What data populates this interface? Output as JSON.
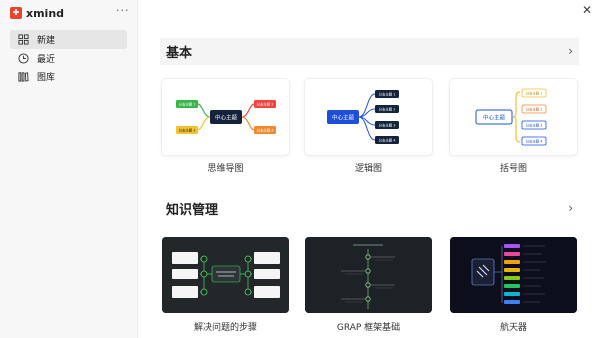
{
  "brand": {
    "name": "xmind",
    "more_label": "···"
  },
  "sidebar": {
    "items": [
      {
        "label": "新建",
        "icon": "grid-icon",
        "active": true
      },
      {
        "label": "最近",
        "icon": "clock-icon",
        "active": false
      },
      {
        "label": "图库",
        "icon": "library-icon",
        "active": false
      }
    ]
  },
  "window": {
    "close_label": "✕"
  },
  "sections": [
    {
      "title": "基本",
      "chevron": "›",
      "templates": [
        {
          "name": "思维导图",
          "center": "中心主题",
          "branches": [
            "分支主题 1",
            "分支主题 2",
            "分支主题 3",
            "分支主题 4"
          ]
        },
        {
          "name": "逻辑图",
          "center": "中心主题",
          "branches": [
            "分支主题 1",
            "分支主题 2",
            "分支主题 3",
            "分支主题 4"
          ]
        },
        {
          "name": "括号图",
          "center": "中心主题",
          "branches": [
            "分支主题 1",
            "分支主题 2",
            "分支主题 3",
            "分支主题 4"
          ]
        }
      ]
    },
    {
      "title": "知识管理",
      "chevron": "›",
      "templates": [
        {
          "name": "解决问题的步骤"
        },
        {
          "name": "GRAP 框架基础"
        },
        {
          "name": "航天器"
        }
      ]
    }
  ],
  "colors": {
    "brand": "#e8432f",
    "center_blue": "#1e4fd8",
    "mindmap_center": "#14223b",
    "branch_green": "#3ab54a",
    "branch_red": "#f0443c",
    "branch_yellow": "#f2c230",
    "branch_orange": "#f08a30"
  }
}
